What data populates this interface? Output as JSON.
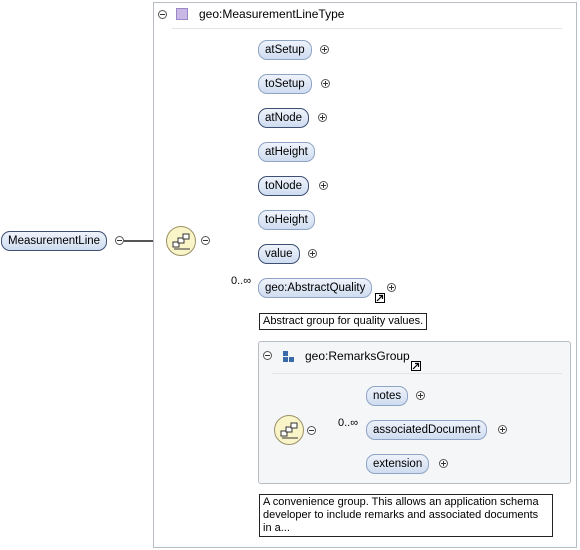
{
  "root_element": {
    "label": "MeasurementLine"
  },
  "complex_type": {
    "title": "geo:MeasurementLineType",
    "icon": "complex-type-icon"
  },
  "children": [
    {
      "label": "atSetup",
      "required": false,
      "expandable": true
    },
    {
      "label": "toSetup",
      "required": false,
      "expandable": true
    },
    {
      "label": "atNode",
      "required": true,
      "expandable": true
    },
    {
      "label": "atHeight",
      "required": false,
      "expandable": false
    },
    {
      "label": "toNode",
      "required": true,
      "expandable": true
    },
    {
      "label": "toHeight",
      "required": false,
      "expandable": false
    },
    {
      "label": "value",
      "required": true,
      "expandable": true
    },
    {
      "label": "geo:AbstractQuality",
      "required": false,
      "expandable": true,
      "cardinality": "0..∞",
      "annotation": "Abstract group for quality values."
    }
  ],
  "remarks_group": {
    "title": "geo:RemarksGroup",
    "icon": "group-icon",
    "children": [
      {
        "label": "notes",
        "cardinality": ""
      },
      {
        "label": "associatedDocument",
        "cardinality": "0..∞"
      },
      {
        "label": "extension",
        "cardinality": ""
      }
    ],
    "annotation": "A convenience group. This allows an application schema developer to include remarks and associated documents in a..."
  },
  "colors": {
    "node_border": "#8fa4c4",
    "node_fill": "#cfdcf0",
    "sequence_fill": "#faf5c8",
    "line": "#555555"
  }
}
